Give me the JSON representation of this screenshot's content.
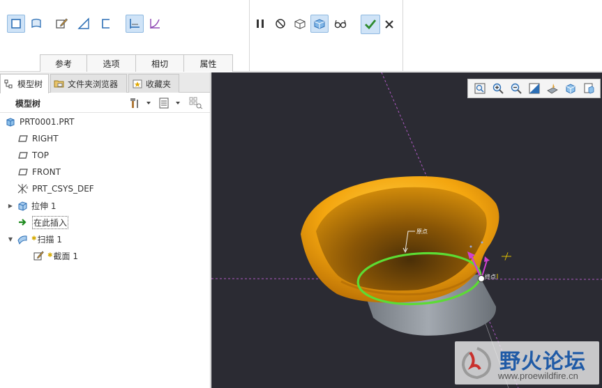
{
  "ribbon": {
    "tabs": [
      "参考",
      "选项",
      "相切",
      "属性"
    ]
  },
  "panel": {
    "tabs": [
      {
        "label": "模型树",
        "icon": "model-tree-icon"
      },
      {
        "label": "文件夹浏览器",
        "icon": "folder-browser-icon"
      },
      {
        "label": "收藏夹",
        "icon": "favorites-icon"
      }
    ],
    "toolbar_title": "模型树"
  },
  "tree": {
    "root": "PRT0001.PRT",
    "right": "RIGHT",
    "top": "TOP",
    "front": "FRONT",
    "csys": "PRT_CSYS_DEF",
    "extrude": "拉伸 1",
    "insert_here": "在此插入",
    "sweep": "扫描 1",
    "section": "截面 1"
  },
  "viewport": {
    "background": "#2b2b33",
    "annotation_origin": "原点",
    "annotation_end": "终点"
  },
  "watermark": {
    "text": "野火论坛",
    "url": "www.proewildfire.cn"
  },
  "colors": {
    "accent": "#cfe3f7",
    "confirm_green": "#2e8b2e",
    "sweep_orange": "#f2a50c",
    "trajectory_green": "#5cdc34",
    "extrude_gray": "#8d939a"
  }
}
